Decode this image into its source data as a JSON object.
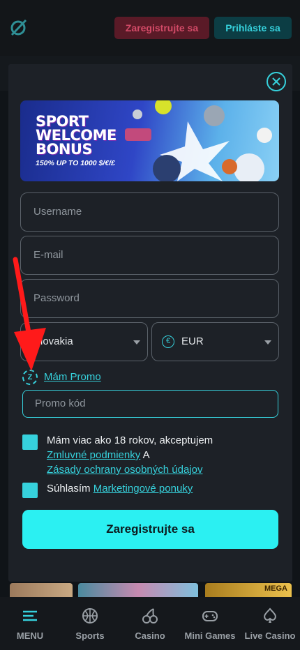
{
  "header": {
    "register_label": "Zaregistrujte sa",
    "login_label": "Prihláste sa"
  },
  "banner": {
    "title": "SPORT WELCOME BONUS",
    "subtitle": "150% UP TO 1000 $/€/£"
  },
  "form": {
    "username_placeholder": "Username",
    "email_placeholder": "E-mail",
    "password_placeholder": "Password",
    "country_value": "Slovakia",
    "currency_value": "EUR",
    "promo_toggle_label": "Mám Promo",
    "promo_placeholder": "Promo kód",
    "age_text": "Mám viac ako 18 rokov, akceptujem",
    "terms_link": "Zmluvné podmienky",
    "and_text": "A",
    "privacy_link": "Zásady ochrany osobných údajov",
    "marketing_prefix": "Súhlasím",
    "marketing_link": "Marketingové ponuky",
    "submit_label": "Zaregistrujte sa"
  },
  "background": {
    "thumb_text": "MEGA"
  },
  "nav": {
    "items": [
      {
        "label": "MENU",
        "icon": "menu-icon"
      },
      {
        "label": "Sports",
        "icon": "basketball-icon"
      },
      {
        "label": "Casino",
        "icon": "cherries-icon"
      },
      {
        "label": "Mini Games",
        "icon": "gamepad-icon"
      },
      {
        "label": "Live Casino",
        "icon": "spade-icon"
      }
    ]
  },
  "colors": {
    "accent": "#36d1dc",
    "submit": "#2bf0f2",
    "annotation_arrow": "#ff1a1a"
  }
}
